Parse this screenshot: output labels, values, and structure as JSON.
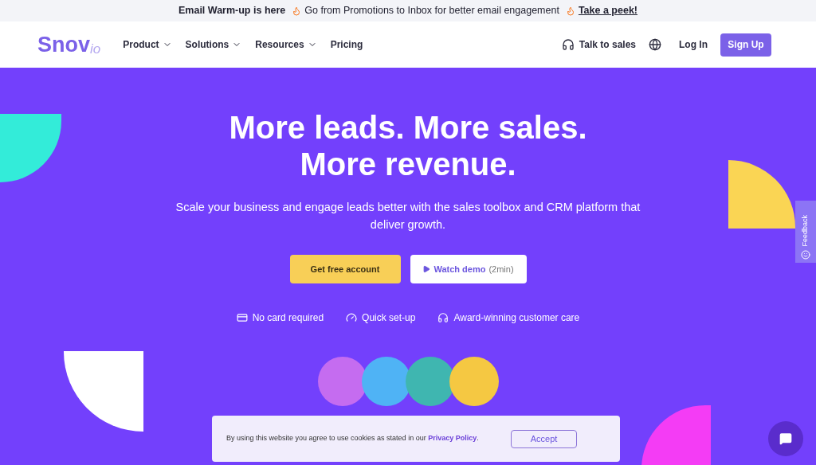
{
  "announcement": {
    "title": "Email Warm-up is here",
    "text": "Go from Promotions to Inbox for better email engagement",
    "link": "Take a peek!"
  },
  "nav": {
    "logo": {
      "name": "Snov",
      "suffix": "io"
    },
    "menu": [
      {
        "label": "Product",
        "dropdown": true
      },
      {
        "label": "Solutions",
        "dropdown": true
      },
      {
        "label": "Resources",
        "dropdown": true
      },
      {
        "label": "Pricing",
        "dropdown": false
      }
    ],
    "talk_to_sales": "Talk to sales",
    "log_in": "Log In",
    "sign_up": "Sign Up"
  },
  "hero": {
    "headline_lines": [
      "More leads. More sales.",
      "More revenue."
    ],
    "subtitle": "Scale your business and engage leads better with the sales toolbox and CRM platform that deliver growth.",
    "primary_button": "Get free account",
    "demo_button": {
      "label": "Watch demo",
      "duration": "(2min)"
    },
    "features": [
      {
        "kind": "card",
        "label": "No card required"
      },
      {
        "kind": "gauge",
        "label": "Quick set-up"
      },
      {
        "kind": "headset",
        "label": "Award-winning customer care"
      }
    ],
    "avatars": [
      {
        "color": "#c56cf0"
      },
      {
        "color": "#4fb3f5"
      },
      {
        "color": "#3fb6b0"
      },
      {
        "color": "#f5c842"
      }
    ]
  },
  "feedback_tab": {
    "label": "Feedback"
  },
  "cookie_banner": {
    "text": "By using this website you agree to use cookies as stated in our",
    "link": "Privacy Policy",
    "end": ".",
    "accept": "Accept"
  }
}
